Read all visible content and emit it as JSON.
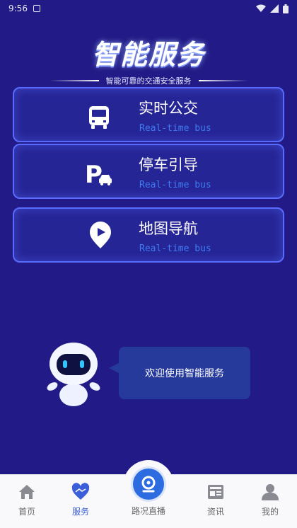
{
  "status_bar": {
    "time": "9:56"
  },
  "hero": {
    "title": "智能服务",
    "subtitle": "智能可靠的交通安全服务"
  },
  "cards": [
    {
      "title": "实时公交",
      "subtitle": "Real-time bus",
      "icon": "bus-icon"
    },
    {
      "title": "停车引导",
      "subtitle": "Real-time bus",
      "icon": "parking-icon"
    },
    {
      "title": "地图导航",
      "subtitle": "Real-time bus",
      "icon": "navigation-pin-icon"
    }
  ],
  "assistant": {
    "message": "欢迎使用智能服务"
  },
  "bottom_nav": {
    "items": [
      {
        "label": "首页",
        "icon": "home-icon",
        "active": false
      },
      {
        "label": "服务",
        "icon": "service-heart-icon",
        "active": true
      },
      {
        "label": "路况直播",
        "icon": "camera-icon",
        "active": false
      },
      {
        "label": "资讯",
        "icon": "news-icon",
        "active": false
      },
      {
        "label": "我的",
        "icon": "user-icon",
        "active": false
      }
    ]
  },
  "colors": {
    "background": "#221a86",
    "card_border": "#5a6cff",
    "accent_text": "#3f7cf0",
    "nav_active": "#3a5fd8"
  }
}
